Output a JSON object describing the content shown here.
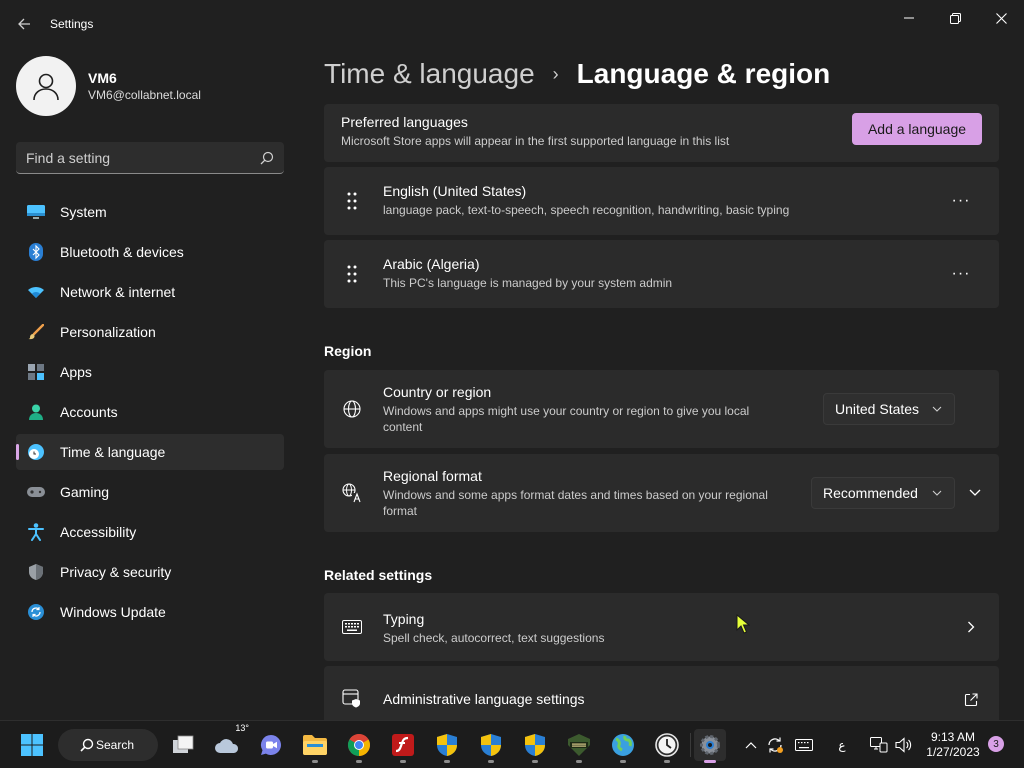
{
  "window": {
    "app_title": "Settings"
  },
  "profile": {
    "name": "VM6",
    "email": "VM6@collabnet.local"
  },
  "search": {
    "placeholder": "Find a setting"
  },
  "sidebar": {
    "items": [
      {
        "label": "System",
        "icon": "monitor-icon"
      },
      {
        "label": "Bluetooth & devices",
        "icon": "bluetooth-icon"
      },
      {
        "label": "Network & internet",
        "icon": "wifi-icon"
      },
      {
        "label": "Personalization",
        "icon": "brush-icon"
      },
      {
        "label": "Apps",
        "icon": "apps-icon"
      },
      {
        "label": "Accounts",
        "icon": "person-icon"
      },
      {
        "label": "Time & language",
        "icon": "clock-globe-icon",
        "active": true
      },
      {
        "label": "Gaming",
        "icon": "gamepad-icon"
      },
      {
        "label": "Accessibility",
        "icon": "accessibility-icon"
      },
      {
        "label": "Privacy & security",
        "icon": "shield-icon"
      },
      {
        "label": "Windows Update",
        "icon": "update-icon"
      }
    ]
  },
  "breadcrumb": {
    "parent": "Time & language",
    "separator": "›",
    "current": "Language & region"
  },
  "preferred_languages": {
    "title": "Preferred languages",
    "description": "Microsoft Store apps will appear in the first supported language in this list",
    "add_button": "Add a language",
    "languages": [
      {
        "name": "English (United States)",
        "detail": "language pack, text-to-speech, speech recognition, handwriting, basic typing"
      },
      {
        "name": "Arabic (Algeria)",
        "detail": "This PC's language is managed by your system admin"
      }
    ],
    "more_label": "···"
  },
  "region": {
    "section_title": "Region",
    "country": {
      "title": "Country or region",
      "description": "Windows and apps might use your country or region to give you local content",
      "value": "United States"
    },
    "format": {
      "title": "Regional format",
      "description": "Windows and some apps format dates and times based on your regional format",
      "value": "Recommended"
    }
  },
  "related": {
    "section_title": "Related settings",
    "typing": {
      "title": "Typing",
      "description": "Spell check, autocorrect, text suggestions"
    },
    "admin": {
      "title": "Administrative language settings"
    }
  },
  "taskbar": {
    "search_label": "Search",
    "weather_temp": "13°",
    "input_indicator": "ع",
    "time": "9:13 AM",
    "date": "1/27/2023",
    "notification_count": "3"
  },
  "colors": {
    "accent": "#d8a0e6",
    "background": "#202020",
    "card": "#2b2b2b"
  }
}
